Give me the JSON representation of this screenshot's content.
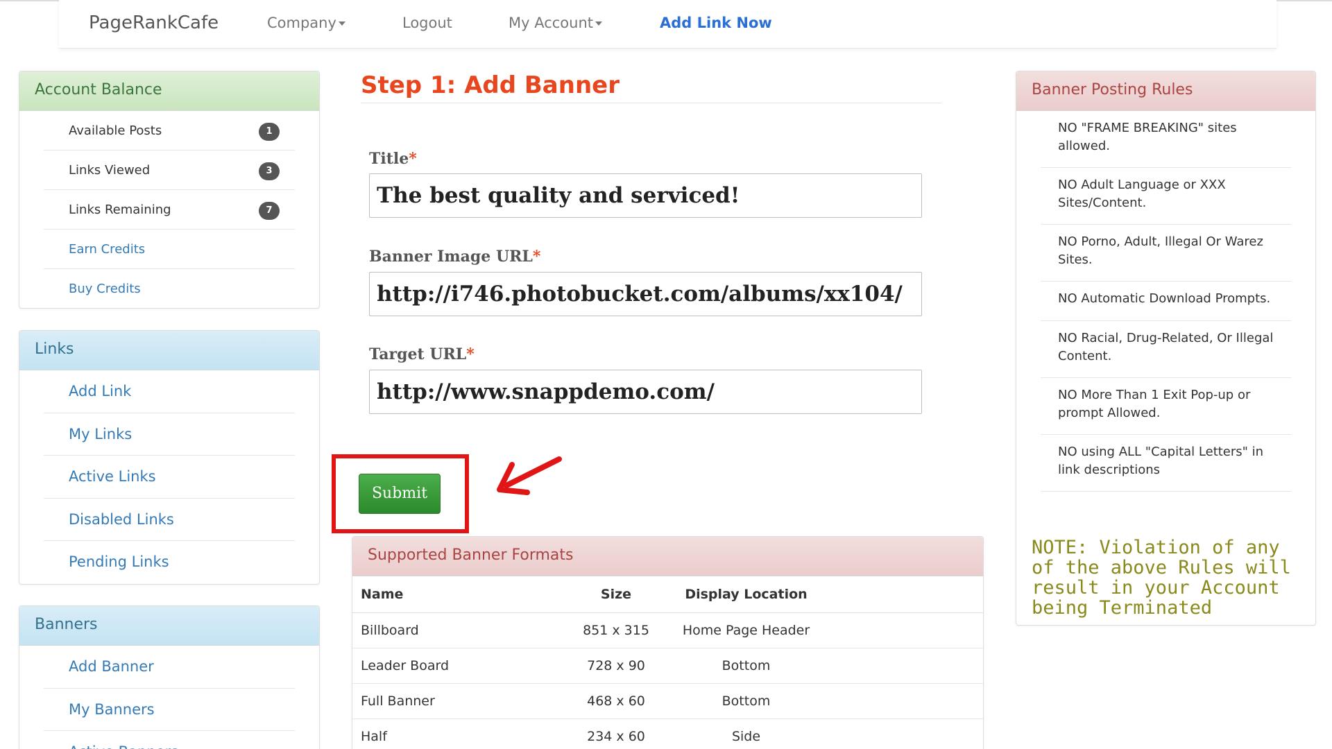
{
  "nav": {
    "brand": "PageRankCafe",
    "company": "Company",
    "logout": "Logout",
    "my_account": "My Account",
    "add_link_now": "Add Link Now"
  },
  "account_balance": {
    "title": "Account Balance",
    "items": [
      {
        "label": "Available Posts",
        "count": "1"
      },
      {
        "label": "Links Viewed",
        "count": "3"
      },
      {
        "label": "Links Remaining",
        "count": "7"
      }
    ],
    "earn_credits": "Earn Credits",
    "buy_credits": "Buy Credits"
  },
  "links_panel": {
    "title": "Links",
    "items": [
      "Add Link",
      "My Links",
      "Active Links",
      "Disabled Links",
      "Pending Links"
    ]
  },
  "banners_panel": {
    "title": "Banners",
    "items": [
      "Add Banner",
      "My Banners",
      "Active Banners"
    ]
  },
  "form": {
    "heading": "Step 1: Add Banner",
    "title_label": "Title",
    "title_value": "The best quality and serviced!",
    "image_label": "Banner Image URL",
    "image_value": "http://i746.photobucket.com/albums/xx104/",
    "target_label": "Target URL",
    "target_value": "http://www.snappdemo.com/",
    "required_mark": "*",
    "submit": "Submit"
  },
  "formats": {
    "title": "Supported Banner Formats",
    "headers": [
      "Name",
      "Size",
      "Display Location"
    ],
    "rows": [
      [
        "Billboard",
        "851 x 315",
        "Home Page Header"
      ],
      [
        "Leader Board",
        "728 x 90",
        "Bottom"
      ],
      [
        "Full Banner",
        "468 x 60",
        "Bottom"
      ],
      [
        "Half",
        "234 x 60",
        "Side"
      ]
    ]
  },
  "rules": {
    "title": "Banner Posting Rules",
    "items": [
      "NO \"FRAME BREAKING\" sites allowed.",
      "NO Adult Language or XXX Sites/Content.",
      "NO Porno, Adult, Illegal Or Warez Sites.",
      "NO Automatic Download Prompts.",
      "NO Racial, Drug-Related, Or Illegal Content.",
      "NO More Than 1 Exit Pop-up or prompt Allowed.",
      "NO using ALL \"Capital Letters\" in link descriptions"
    ],
    "note": "NOTE: Violation of any of the above Rules will result in your Account being Terminated"
  },
  "colors": {
    "accent_orange": "#e8461e",
    "link_blue": "#337ab7",
    "submit_green": "#3c9a3c",
    "highlight_red": "#e01616"
  }
}
